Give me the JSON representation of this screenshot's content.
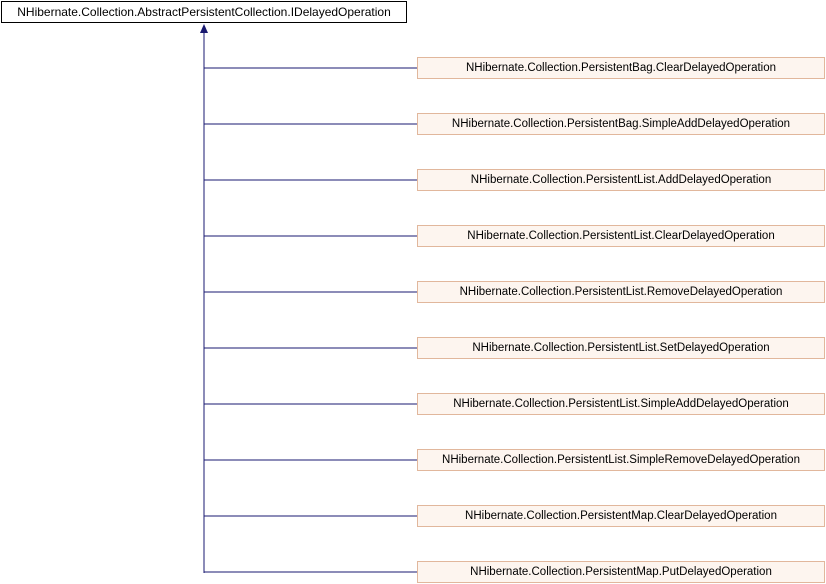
{
  "diagram": {
    "root": {
      "label": "NHibernate.Collection.AbstractPersistentCollection.IDelayedOperation"
    },
    "children": [
      {
        "label": "NHibernate.Collection.PersistentBag.ClearDelayedOperation"
      },
      {
        "label": "NHibernate.Collection.PersistentBag.SimpleAddDelayedOperation"
      },
      {
        "label": "NHibernate.Collection.PersistentList.AddDelayedOperation"
      },
      {
        "label": "NHibernate.Collection.PersistentList.ClearDelayedOperation"
      },
      {
        "label": "NHibernate.Collection.PersistentList.RemoveDelayedOperation"
      },
      {
        "label": "NHibernate.Collection.PersistentList.SetDelayedOperation"
      },
      {
        "label": "NHibernate.Collection.PersistentList.SimpleAddDelayedOperation"
      },
      {
        "label": "NHibernate.Collection.PersistentList.SimpleRemoveDelayedOperation"
      },
      {
        "label": "NHibernate.Collection.PersistentMap.ClearDelayedOperation"
      },
      {
        "label": "NHibernate.Collection.PersistentMap.PutDelayedOperation"
      }
    ],
    "colors": {
      "edge": "#191970",
      "child_fill": "#fdf5ef",
      "child_border": "#e1b79c",
      "root_border": "#000000"
    }
  }
}
